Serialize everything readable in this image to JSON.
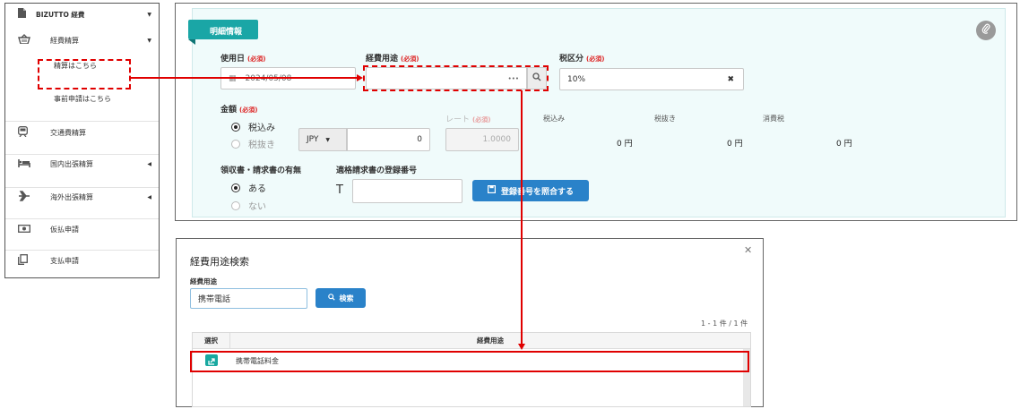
{
  "sidebar": {
    "app_title": "BIZUTTO 経費",
    "items": [
      {
        "label": "経費精算",
        "icon": "basket-icon"
      },
      {
        "label": "精算はこちら"
      },
      {
        "label": "事前申請はこちら"
      },
      {
        "label": "交通費精算",
        "icon": "train-icon"
      },
      {
        "label": "国内出張精算",
        "icon": "bed-icon"
      },
      {
        "label": "海外出張精算",
        "icon": "airplane-icon"
      },
      {
        "label": "仮払申請",
        "icon": "money-icon"
      },
      {
        "label": "支払申請",
        "icon": "copy-icon"
      }
    ]
  },
  "detail": {
    "section_title": "明細情報",
    "required": "(必須)",
    "use_date": {
      "label": "使用日",
      "value": "2024/05/08"
    },
    "expense_purpose": {
      "label": "経費用途",
      "value": "",
      "more": "•••"
    },
    "tax_category": {
      "label": "税区分",
      "value": "10%"
    },
    "amount": {
      "label": "金額",
      "options": [
        "税込み",
        "税抜き"
      ],
      "currency": "JPY",
      "value": "0"
    },
    "rate": {
      "label": "レート",
      "value": "1.0000"
    },
    "columns": [
      {
        "label": "税込み",
        "value": "0 円"
      },
      {
        "label": "税抜き",
        "value": "0 円"
      },
      {
        "label": "消費税",
        "value": "0 円"
      }
    ],
    "receipt": {
      "label": "領収書・請求書の有無",
      "options": [
        "ある",
        "ない"
      ]
    },
    "invoice": {
      "label": "適格請求書の登録番号",
      "prefix": "T",
      "value": "",
      "button": "登録番号を照合する"
    }
  },
  "modal": {
    "title": "経費用途検索",
    "field_label": "経費用途",
    "search_value": "携帯電話",
    "search_button": "検索",
    "count": "1 - 1 件 / 1 件",
    "headers": [
      "選択",
      "経費用途"
    ],
    "rows": [
      {
        "purpose": "携帯電話料金"
      }
    ]
  },
  "colors": {
    "accent": "#1aa6a6",
    "primary": "#2a82c9",
    "annotation": "#e00000"
  }
}
